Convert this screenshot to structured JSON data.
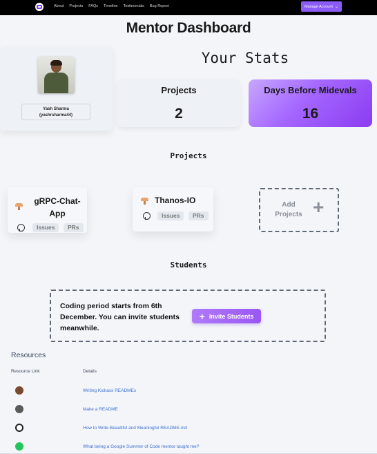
{
  "nav": {
    "links": [
      "About",
      "Projects",
      "FAQs",
      "Timeline",
      "Testimonials",
      "Bug Report"
    ],
    "manage_label": "Manage Account"
  },
  "page_title": "Mentor Dashboard",
  "stats_title": "Your Stats",
  "profile": {
    "name": "Yash Sharma",
    "username": "(yashrsharma44)"
  },
  "stats": {
    "projects_label": "Projects",
    "projects_value": "2",
    "days_label": "Days Before Midevals",
    "days_value": "16"
  },
  "projects_heading": "Projects",
  "projects": [
    {
      "name_line1": "gRPC-Chat-",
      "name_line2": "App",
      "issues": "Issues",
      "prs": "PRs"
    },
    {
      "name_line1": "Thanos-IO",
      "issues": "Issues",
      "prs": "PRs"
    }
  ],
  "add_project": {
    "line1": "Add",
    "line2": "Projects"
  },
  "students_heading": "Students",
  "students": {
    "message": "Coding period starts from 6th December. You can invite students meanwhile.",
    "invite_label": "Invite Students"
  },
  "resources": {
    "title": "Resources",
    "col_link": "Resource Link",
    "col_details": "Details",
    "items": [
      {
        "details": "Writing Kickass READMEs",
        "avatar_color": "#7a4a2e"
      },
      {
        "details": "Make a README",
        "avatar_color": "#5a5a5a"
      },
      {
        "details": "How to Write Beautiful and Meaningful README.md",
        "avatar_color": "#222222"
      },
      {
        "details": "What being a Google Summer of Code mentor taught me?",
        "avatar_color": "#22c55e"
      }
    ]
  },
  "colors": {
    "accent": "#8b5cf6",
    "link": "#3c6fd1"
  }
}
